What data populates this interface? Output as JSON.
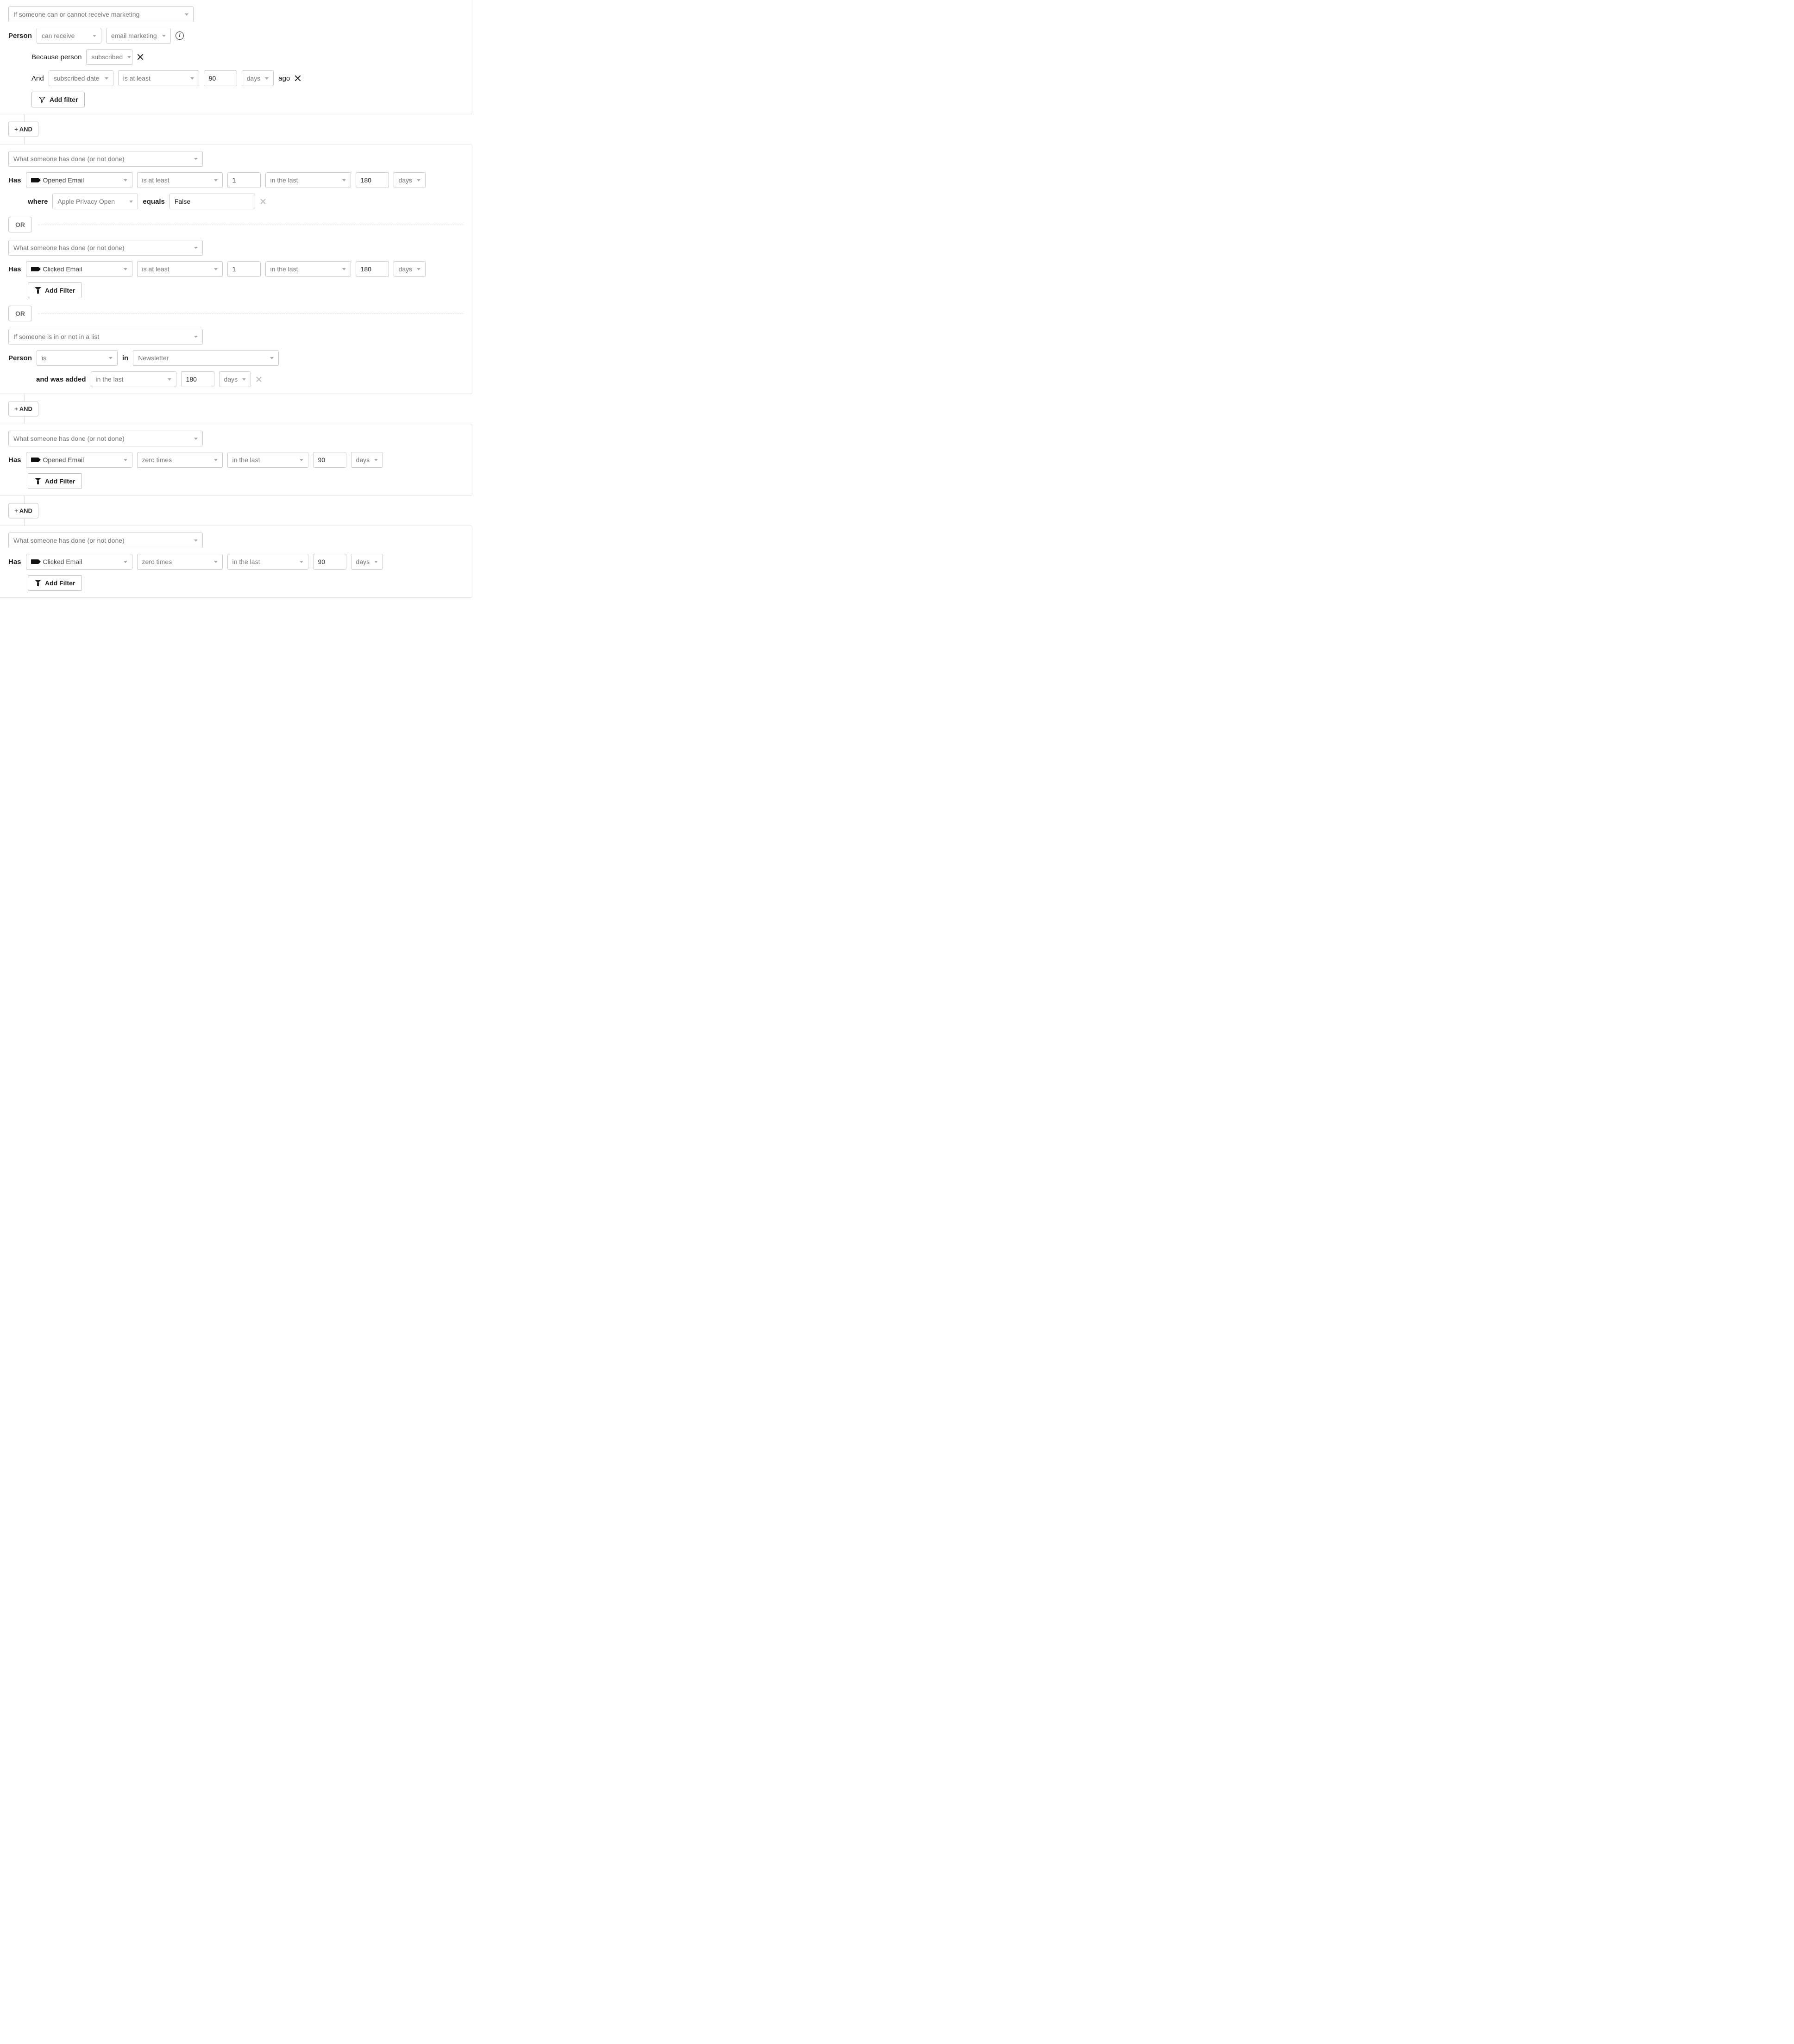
{
  "common": {
    "and_chip": "+ AND",
    "or_chip": "OR",
    "add_filter": "Add filter",
    "add_filter_title": "Add Filter",
    "ago": "ago",
    "in": "in",
    "info_glyph": "i"
  },
  "g1": {
    "cond_type": "If someone can or cannot receive marketing",
    "subject": "Person",
    "verb": "can receive",
    "channel": "email marketing",
    "because_label": "Because person",
    "because_value": "subscribed",
    "and_label": "And",
    "attr": "subscribed date",
    "op": "is at least",
    "num": "90",
    "unit": "days"
  },
  "g2a": {
    "cond_type": "What someone has done (or not done)",
    "has": "Has",
    "event": "Opened Email",
    "op": "is at least",
    "count": "1",
    "range": "in the last",
    "num": "180",
    "unit": "days",
    "where": "where",
    "where_attr": "Apple Privacy Open",
    "equals": "equals",
    "where_val": "False"
  },
  "g2b": {
    "cond_type": "What someone has done (or not done)",
    "has": "Has",
    "event": "Clicked Email",
    "op": "is at least",
    "count": "1",
    "range": "in the last",
    "num": "180",
    "unit": "days"
  },
  "g2c": {
    "cond_type": "If someone is in or not in a list",
    "subject": "Person",
    "verb": "is",
    "list": "Newsletter",
    "added_label": "and was added",
    "range": "in the last",
    "num": "180",
    "unit": "days"
  },
  "g3": {
    "cond_type": "What someone has done (or not done)",
    "has": "Has",
    "event": "Opened Email",
    "op": "zero times",
    "range": "in the last",
    "num": "90",
    "unit": "days"
  },
  "g4": {
    "cond_type": "What someone has done (or not done)",
    "has": "Has",
    "event": "Clicked Email",
    "op": "zero times",
    "range": "in the last",
    "num": "90",
    "unit": "days"
  }
}
